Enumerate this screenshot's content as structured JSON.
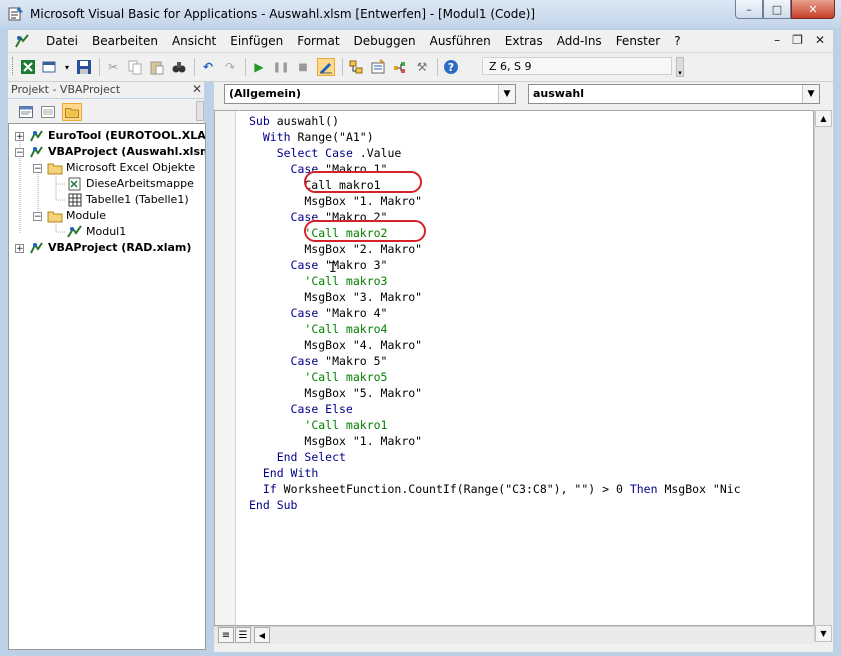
{
  "window": {
    "title": "Microsoft Visual Basic for Applications - Auswahl.xlsm [Entwerfen] - [Modul1 (Code)]",
    "buttons": {
      "minimize": "–",
      "maximize": "□",
      "close": "✕"
    }
  },
  "menubar": {
    "items": [
      "Datei",
      "Bearbeiten",
      "Ansicht",
      "Einfügen",
      "Format",
      "Debuggen",
      "Ausführen",
      "Extras",
      "Add-Ins",
      "Fenster",
      "?"
    ],
    "mdi": {
      "minimize": "–",
      "restore": "❐",
      "close": "✕"
    }
  },
  "toolbar": {
    "position_text": "Z 6, S 9"
  },
  "project_panel": {
    "title": "Projekt - VBAProject",
    "close": "✕",
    "tree": [
      {
        "label": "EuroTool (EUROTOOL.XLAM)",
        "expander": "+"
      },
      {
        "label": "VBAProject (Auswahl.xlsm)",
        "expander": "−"
      },
      {
        "label": "Microsoft Excel Objekte",
        "expander": "−"
      },
      {
        "label": "DieseArbeitsmappe"
      },
      {
        "label": "Tabelle1 (Tabelle1)"
      },
      {
        "label": "Module",
        "expander": "−"
      },
      {
        "label": "Modul1"
      },
      {
        "label": "VBAProject (RAD.xlam)",
        "expander": "+"
      }
    ]
  },
  "code_window": {
    "object_combo": "(Allgemein)",
    "procedure_combo": "auswahl",
    "lines": [
      [
        {
          "t": "Sub",
          "k": "kw"
        },
        {
          "t": " auswahl()"
        }
      ],
      [
        {
          "t": "  "
        },
        {
          "t": "With",
          "k": "kw"
        },
        {
          "t": " Range(\"A1\")"
        }
      ],
      [
        {
          "t": "    "
        },
        {
          "t": "Select Case",
          "k": "kw"
        },
        {
          "t": " .Value"
        }
      ],
      [
        {
          "t": "      "
        },
        {
          "t": "Case",
          "k": "kw"
        },
        {
          "t": " \"Makro 1\""
        }
      ],
      [
        {
          "t": "        Call makro1"
        }
      ],
      [
        {
          "t": "        MsgBox \"1. Makro\""
        }
      ],
      [
        {
          "t": "      "
        },
        {
          "t": "Case",
          "k": "kw"
        },
        {
          "t": " \"Makro 2\""
        }
      ],
      [
        {
          "t": "        "
        },
        {
          "t": "'Call makro2",
          "k": "cmt"
        }
      ],
      [
        {
          "t": "        MsgBox \"2. Makro\""
        }
      ],
      [
        {
          "t": "      "
        },
        {
          "t": "Case",
          "k": "kw"
        },
        {
          "t": " \"Makro 3\""
        }
      ],
      [
        {
          "t": "        "
        },
        {
          "t": "'Call makro3",
          "k": "cmt"
        }
      ],
      [
        {
          "t": "        MsgBox \"3. Makro\""
        }
      ],
      [
        {
          "t": "      "
        },
        {
          "t": "Case",
          "k": "kw"
        },
        {
          "t": " \"Makro 4\""
        }
      ],
      [
        {
          "t": "        "
        },
        {
          "t": "'Call makro4",
          "k": "cmt"
        }
      ],
      [
        {
          "t": "        MsgBox \"4. Makro\""
        }
      ],
      [
        {
          "t": "      "
        },
        {
          "t": "Case",
          "k": "kw"
        },
        {
          "t": " \"Makro 5\""
        }
      ],
      [
        {
          "t": "        "
        },
        {
          "t": "'Call makro5",
          "k": "cmt"
        }
      ],
      [
        {
          "t": "        MsgBox \"5. Makro\""
        }
      ],
      [
        {
          "t": "      "
        },
        {
          "t": "Case Else",
          "k": "kw"
        }
      ],
      [
        {
          "t": "        "
        },
        {
          "t": "'Call makro1",
          "k": "cmt"
        }
      ],
      [
        {
          "t": "        MsgBox \"1. Makro\""
        }
      ],
      [
        {
          "t": "    "
        },
        {
          "t": "End Select",
          "k": "kw"
        }
      ],
      [
        {
          "t": "  "
        },
        {
          "t": "End With",
          "k": "kw"
        }
      ],
      [
        {
          "t": "  "
        },
        {
          "t": "If",
          "k": "kw"
        },
        {
          "t": " WorksheetFunction.CountIf(Range(\"C3:C8\"), \"\") > 0 "
        },
        {
          "t": "Then",
          "k": "kw"
        },
        {
          "t": " MsgBox \"Nic"
        }
      ],
      [
        {
          "t": "End Sub",
          "k": "kw"
        }
      ]
    ]
  },
  "colors": {
    "keyword": "#00008b",
    "comment": "#008000",
    "highlight": "#d5232b"
  }
}
